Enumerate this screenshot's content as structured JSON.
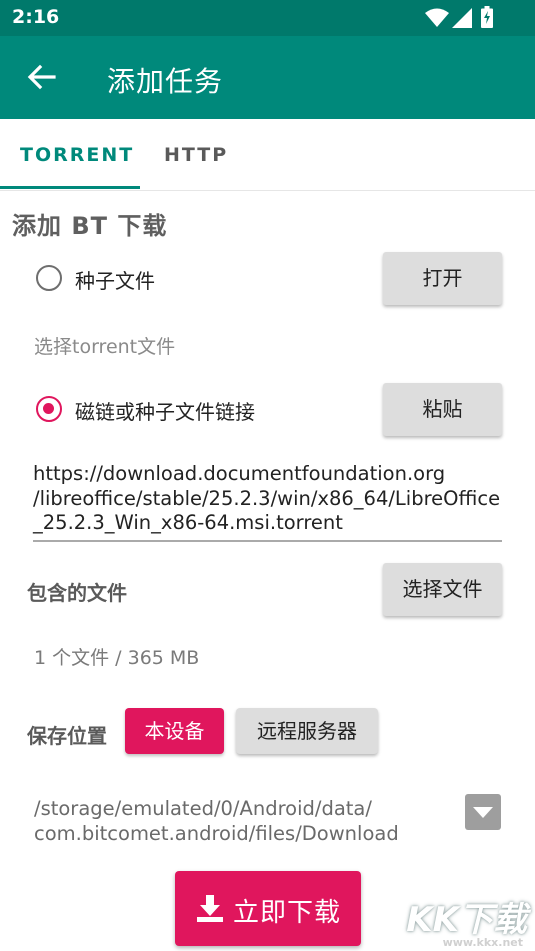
{
  "status_bar": {
    "time": "2:16"
  },
  "app_bar": {
    "title": "添加任务"
  },
  "tabs": [
    {
      "label": "TORRENT",
      "active": true
    },
    {
      "label": "HTTP",
      "active": false
    }
  ],
  "section_title": "添加 BT 下载",
  "torrent_file": {
    "radio_label": "种子文件",
    "checked": false,
    "open_button": "打开",
    "hint": "选择torrent文件"
  },
  "magnet": {
    "radio_label": "磁链或种子文件链接",
    "checked": true,
    "paste_button": "粘贴",
    "url_lines": [
      "https://download.documentfoundation.org",
      "/libreoffice/stable/25.2.3/win/x86_64/LibreOffice",
      "_25.2.3_Win_x86-64.msi.torrent"
    ]
  },
  "files": {
    "label": "包含的文件",
    "select_button": "选择文件",
    "summary": "1 个文件 / 365 MB"
  },
  "save_location": {
    "label": "保存位置",
    "options": [
      {
        "label": "本设备",
        "selected": true
      },
      {
        "label": "远程服务器",
        "selected": false
      }
    ],
    "path_lines": [
      "/storage/emulated/0/Android/data/",
      "com.bitcomet.android/files/Download"
    ]
  },
  "download_button": "立即下载",
  "watermark": {
    "title": "KK下载",
    "url": "www.kkx.net"
  },
  "colors": {
    "primary": "#00897b",
    "status_bar": "#00796b",
    "accent": "#e0165d",
    "button_gray": "#dddddd"
  }
}
